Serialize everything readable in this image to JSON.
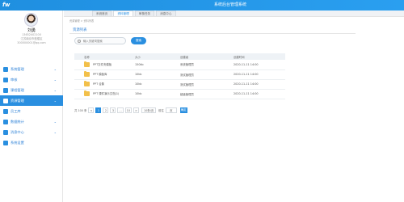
{
  "app": {
    "logo": "fw",
    "title": "系统后台管理系统"
  },
  "user": {
    "name": "刘勇",
    "lines": [
      "13652402100",
      "江苏南京市鼓楼区",
      "300000001@qq.com"
    ]
  },
  "menu": [
    {
      "label": "系统管理",
      "active": false
    },
    {
      "label": "审核",
      "active": false
    },
    {
      "label": "课程管理",
      "active": false
    },
    {
      "label": "资源管理",
      "active": true
    },
    {
      "label": "员工库",
      "active": false
    },
    {
      "label": "数据统计",
      "active": false
    },
    {
      "label": "消息中心",
      "active": false
    },
    {
      "label": "系统设置",
      "active": false
    }
  ],
  "tabs": [
    {
      "label": "系统首页",
      "active": false
    },
    {
      "label": "资料管理",
      "active": true
    },
    {
      "label": "审核任务",
      "active": false
    },
    {
      "label": "消息中心",
      "active": false
    }
  ],
  "breadcrumb": "资源管理 > 资料列表",
  "section_title": "资源列表",
  "search": {
    "placeholder": "输入关键词搜索",
    "button": "搜索"
  },
  "table": {
    "headers": [
      "名称",
      "大小",
      "创建者",
      "创建时间"
    ],
    "rows": [
      [
        "PPT文件夹模板",
        "150kb",
        "系统管理员",
        "2020-11-11 14:00"
      ],
      [
        "PPT 模板库",
        "10kb",
        "测试管理员",
        "2020-11-11 14:00"
      ],
      [
        "PPT 合集",
        "10kb",
        "测试管理员",
        "2020-11-11 14:00"
      ],
      [
        "PPT 课件演示文档(1)",
        "10kb",
        "超级管理员",
        "2020-11-11 14:00"
      ]
    ]
  },
  "pager": {
    "total": "共 100 条",
    "prev": "<",
    "pages": [
      "1",
      "2",
      "3",
      "...",
      "10"
    ],
    "next": ">",
    "per_page": "10条/页",
    "goto_label": "前往",
    "goto_value": "页",
    "go": "确定"
  }
}
